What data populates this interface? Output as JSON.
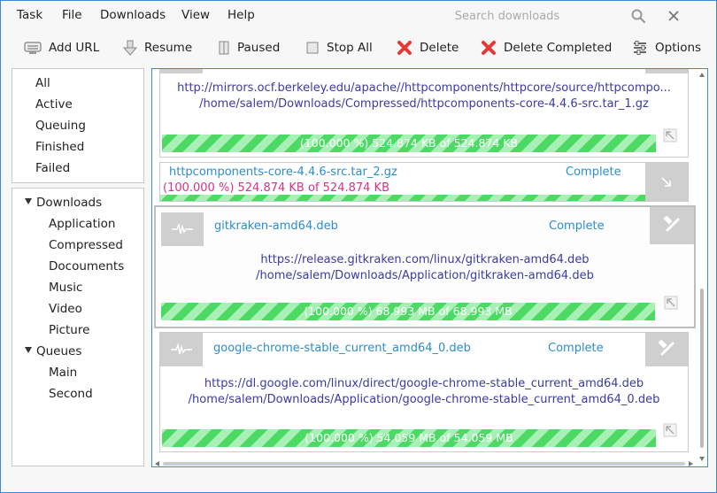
{
  "menu": {
    "task": "Task",
    "file": "File",
    "downloads": "Downloads",
    "view": "View",
    "help": "Help"
  },
  "search": {
    "placeholder": "Search downloads"
  },
  "toolbar": {
    "add_url": "Add URL",
    "resume": "Resume",
    "paused": "Paused",
    "stop_all": "Stop All",
    "delete": "Delete",
    "delete_completed": "Delete Completed",
    "options": "Options"
  },
  "categories": [
    "All",
    "Active",
    "Queuing",
    "Finished",
    "Failed"
  ],
  "tree": {
    "downloads": "Downloads",
    "download_children": [
      "Application",
      "Compressed",
      "Docouments",
      "Music",
      "Video",
      "Picture"
    ],
    "queues": "Queues",
    "queue_children": [
      "Main",
      "Second"
    ]
  },
  "items": [
    {
      "url": "http://mirrors.ocf.berkeley.edu/apache//httpcomponents/httpcore/source/httpcompo...",
      "path": "/home/salem/Downloads/Compressed/httpcomponents-core-4.4.6-src.tar_1.gz",
      "progress_text": "(100.000 %) 524.874 KB of 524.874 KB",
      "progress": 1.0
    },
    {
      "name": "httpcomponents-core-4.4.6-src.tar_2.gz",
      "status": "Complete",
      "progress_text": "(100.000 %) 524.874 KB of 524.874 KB",
      "progress": 1.0
    },
    {
      "name": "gitkraken-amd64.deb",
      "status": "Complete",
      "url": "https://release.gitkraken.com/linux/gitkraken-amd64.deb",
      "path": "/home/salem/Downloads/Application/gitkraken-amd64.deb",
      "progress_text": "(100.000 %) 68.993 MB of 68.993 MB",
      "progress": 1.0
    },
    {
      "name": "google-chrome-stable_current_amd64_0.deb",
      "status": "Complete",
      "url": "https://dl.google.com/linux/direct/google-chrome-stable_current_amd64.deb",
      "path": "/home/salem/Downloads/Application/google-chrome-stable_current_amd64_0.deb",
      "progress_text": "(100.000 %) 54.059 MB of 54.059 MB",
      "progress": 1.0
    }
  ],
  "colors": {
    "accent": "#3a8ad6",
    "progress_green": "#4cd964",
    "progress_light": "#a8f0b6",
    "link": "#3b3ba0",
    "name": "#2c8dcc",
    "status_pink": "#d63384",
    "delete_red": "#e53935"
  }
}
